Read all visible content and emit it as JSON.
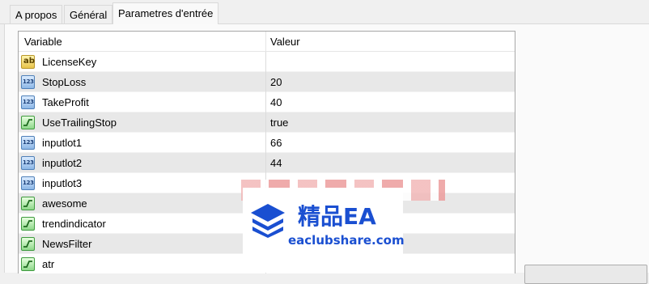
{
  "tabs": [
    {
      "label": "A propos"
    },
    {
      "label": "Général"
    },
    {
      "label": "Parametres d'entrée"
    }
  ],
  "table": {
    "columns": [
      "Variable",
      "Valeur"
    ],
    "rows": [
      {
        "name": "LicenseKey",
        "value": "",
        "icon": "string-ab-icon"
      },
      {
        "name": "StopLoss",
        "value": "20",
        "icon": "number-123-icon"
      },
      {
        "name": "TakeProfit",
        "value": "40",
        "icon": "number-123-icon"
      },
      {
        "name": "UseTrailingStop",
        "value": "true",
        "icon": "boolean-switch-icon"
      },
      {
        "name": "inputlot1",
        "value": "66",
        "icon": "number-123-icon"
      },
      {
        "name": "inputlot2",
        "value": "44",
        "icon": "number-123-icon"
      },
      {
        "name": "inputlot3",
        "value": "",
        "icon": "number-123-icon"
      },
      {
        "name": "awesome",
        "value": "",
        "icon": "boolean-switch-icon"
      },
      {
        "name": "trendindicator",
        "value": "",
        "icon": "boolean-switch-icon"
      },
      {
        "name": "NewsFilter",
        "value": "",
        "icon": "boolean-switch-icon"
      },
      {
        "name": "atr",
        "value": "",
        "icon": "boolean-switch-icon"
      }
    ]
  },
  "icons": {
    "string_glyph": "ab",
    "number_glyph": "123"
  },
  "watermark": {
    "title": "精品EA",
    "site": "eaclubshare.com",
    "color": "#1a4fd1"
  }
}
